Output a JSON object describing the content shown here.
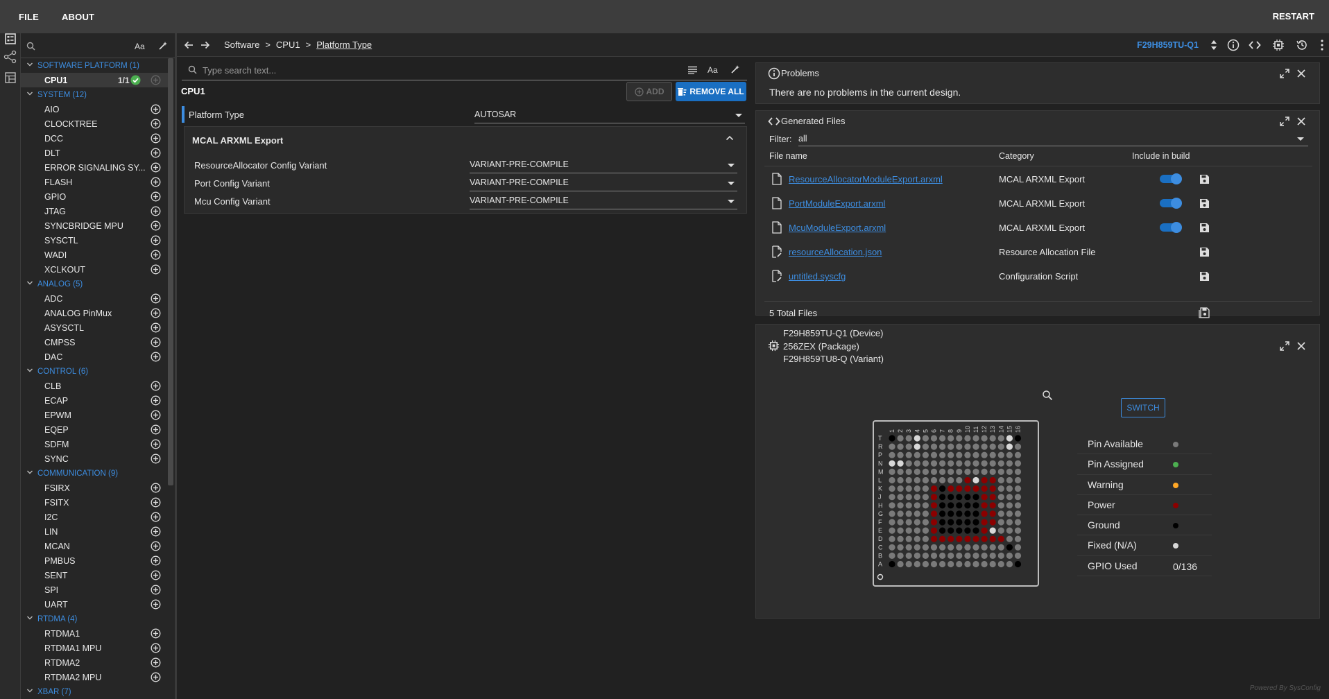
{
  "topbar": {
    "file": "FILE",
    "about": "ABOUT",
    "restart": "RESTART"
  },
  "sidebar": {
    "search_placeholder": "",
    "case_toggle": "Aa",
    "categories": [
      {
        "label": "SOFTWARE PLATFORM (1)",
        "items": [
          {
            "label": "CPU1",
            "count": "1/1",
            "selected": true
          }
        ]
      },
      {
        "label": "SYSTEM (12)",
        "items": [
          {
            "label": "AIO"
          },
          {
            "label": "CLOCKTREE"
          },
          {
            "label": "DCC"
          },
          {
            "label": "DLT"
          },
          {
            "label": "ERROR SIGNALING SY..."
          },
          {
            "label": "FLASH"
          },
          {
            "label": "GPIO"
          },
          {
            "label": "JTAG"
          },
          {
            "label": "SYNCBRIDGE MPU"
          },
          {
            "label": "SYSCTL"
          },
          {
            "label": "WADI"
          },
          {
            "label": "XCLKOUT"
          }
        ]
      },
      {
        "label": "ANALOG (5)",
        "items": [
          {
            "label": "ADC"
          },
          {
            "label": "ANALOG PinMux"
          },
          {
            "label": "ASYSCTL"
          },
          {
            "label": "CMPSS"
          },
          {
            "label": "DAC"
          }
        ]
      },
      {
        "label": "CONTROL (6)",
        "items": [
          {
            "label": "CLB"
          },
          {
            "label": "ECAP"
          },
          {
            "label": "EPWM"
          },
          {
            "label": "EQEP"
          },
          {
            "label": "SDFM"
          },
          {
            "label": "SYNC"
          }
        ]
      },
      {
        "label": "COMMUNICATION (9)",
        "items": [
          {
            "label": "FSIRX"
          },
          {
            "label": "FSITX"
          },
          {
            "label": "I2C"
          },
          {
            "label": "LIN"
          },
          {
            "label": "MCAN"
          },
          {
            "label": "PMBUS"
          },
          {
            "label": "SENT"
          },
          {
            "label": "SPI"
          },
          {
            "label": "UART"
          }
        ]
      },
      {
        "label": "RTDMA (4)",
        "items": [
          {
            "label": "RTDMA1"
          },
          {
            "label": "RTDMA1 MPU"
          },
          {
            "label": "RTDMA2"
          },
          {
            "label": "RTDMA2 MPU"
          }
        ]
      },
      {
        "label": "XBAR (7)",
        "items": []
      }
    ]
  },
  "breadcrumb": {
    "items": [
      "Software",
      "CPU1",
      "Platform Type"
    ],
    "separator": ">"
  },
  "device_selector": "F29H859TU-Q1",
  "config": {
    "search_placeholder": "Type search text...",
    "case_toggle": "Aa",
    "title": "CPU1",
    "add_label": "ADD",
    "remove_all_label": "REMOVE ALL",
    "platform_type": {
      "label": "Platform Type",
      "value": "AUTOSAR"
    },
    "group": {
      "title": "MCAL ARXML Export",
      "rows": [
        {
          "label": "ResourceAllocator Config Variant",
          "value": "VARIANT-PRE-COMPILE"
        },
        {
          "label": "Port Config Variant",
          "value": "VARIANT-PRE-COMPILE"
        },
        {
          "label": "Mcu Config Variant",
          "value": "VARIANT-PRE-COMPILE"
        }
      ]
    }
  },
  "problems": {
    "title": "Problems",
    "message": "There are no problems in the current design."
  },
  "generated": {
    "title": "Generated Files",
    "filter_label": "Filter:",
    "filter_value": "all",
    "col_name": "File name",
    "col_category": "Category",
    "col_include": "Include in build",
    "files": [
      {
        "name": "ResourceAllocatorModuleExport.arxml",
        "category": "MCAL ARXML Export",
        "include": true,
        "icon": "file-icon"
      },
      {
        "name": "PortModuleExport.arxml",
        "category": "MCAL ARXML Export",
        "include": true,
        "icon": "file-icon"
      },
      {
        "name": "McuModuleExport.arxml",
        "category": "MCAL ARXML Export",
        "include": true,
        "icon": "file-icon"
      },
      {
        "name": "resourceAllocation.json",
        "category": "Resource Allocation File",
        "include": false,
        "icon": "file-edit-icon"
      },
      {
        "name": "untitled.syscfg",
        "category": "Configuration Script",
        "include": false,
        "icon": "file-edit-icon"
      }
    ],
    "total": "5 Total Files"
  },
  "device": {
    "device": "F29H859TU-Q1 (Device)",
    "package": "256ZEX (Package)",
    "variant": "F29H859TU8-Q (Variant)",
    "switch_label": "SWITCH",
    "col_numbers": [
      "1",
      "2",
      "3",
      "4",
      "5",
      "6",
      "7",
      "8",
      "9",
      "10",
      "11",
      "12",
      "13",
      "14",
      "15",
      "16"
    ],
    "row_letters": [
      "T",
      "R",
      "P",
      "N",
      "M",
      "L",
      "K",
      "J",
      "H",
      "G",
      "F",
      "E",
      "D",
      "C",
      "B",
      "A"
    ],
    "legend": [
      {
        "label": "Pin Available",
        "color": "#7a7a7a"
      },
      {
        "label": "Pin Assigned",
        "color": "#4caf50"
      },
      {
        "label": "Warning",
        "color": "#ffa726"
      },
      {
        "label": "Power",
        "color": "#8b0000"
      },
      {
        "label": "Ground",
        "color": "#000000"
      },
      {
        "label": "Fixed (N/A)",
        "color": "#d8d8d8"
      }
    ],
    "gpio_used_label": "GPIO Used",
    "gpio_used_value": "0/136"
  },
  "watermark": "Powered By SysConfig",
  "colors": {
    "accent": "#3d8de0",
    "primary_button": "#1a6fc2",
    "background": "#212121",
    "panel": "#2d2d2d"
  }
}
